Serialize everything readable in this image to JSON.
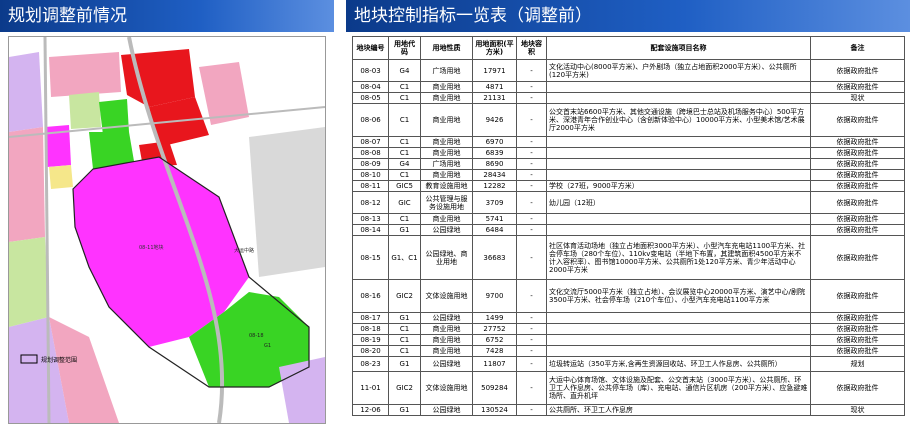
{
  "headers": {
    "left": "规划调整前情况",
    "right": "地块控制指标一览表（调整前）"
  },
  "map": {
    "legend_label": "规划调整范围",
    "labels": {
      "plot_magenta": "08-11地块",
      "road_label": "大运中路",
      "label_g1": "08-18",
      "label_c1": "G1"
    },
    "colors": {
      "commercial": "#e8161d",
      "residential_pink": "#f2a6c0",
      "green": "#39d424",
      "education": "#ff33ff",
      "light_green": "#c8e6a0",
      "grey": "#d9d9d9",
      "lavender": "#d4b4f0",
      "yellow": "#f5e78a"
    }
  },
  "table": {
    "columns": [
      "地块编号",
      "用地代码",
      "用地性质",
      "用地面积(平方米)",
      "地块容积",
      "配套设施项目名称",
      "备注"
    ],
    "rows": [
      [
        "08-03",
        "G4",
        "广场用地",
        "17971",
        "-",
        "文化活动中心(8000平方米)、户外剧场（独立占地面积2000平方米）、公共厕所(120平方米)",
        "依据政府批件"
      ],
      [
        "08-04",
        "C1",
        "商业用地",
        "4871",
        "-",
        "",
        "依据政府批件"
      ],
      [
        "08-05",
        "C1",
        "商业用地",
        "21131",
        "-",
        "",
        "现状"
      ],
      [
        "08-06",
        "C1",
        "商业用地",
        "9426",
        "-",
        "公交首末站6600平方米、其他交通设施（跨境巴士总站及机场服务中心）500平方米、深港青年合作创业中心（含创新体验中心）10000平方米、小型美术馆/艺术展厅2000平方米",
        "依据政府批件"
      ],
      [
        "08-07",
        "C1",
        "商业用地",
        "6970",
        "-",
        "",
        "依据政府批件"
      ],
      [
        "08-08",
        "C1",
        "商业用地",
        "6839",
        "-",
        "",
        "依据政府批件"
      ],
      [
        "08-09",
        "G4",
        "广场用地",
        "8690",
        "-",
        "",
        "依据政府批件"
      ],
      [
        "08-10",
        "C1",
        "商业用地",
        "28434",
        "-",
        "",
        "依据政府批件"
      ],
      [
        "08-11",
        "GIC5",
        "教育设施用地",
        "12282",
        "-",
        "学校（27班，9000平方米）",
        "依据政府批件"
      ],
      [
        "08-12",
        "GIC",
        "公共管理与服务设施用地",
        "3709",
        "-",
        "幼儿园（12班）",
        "依据政府批件"
      ],
      [
        "08-13",
        "C1",
        "商业用地",
        "5741",
        "-",
        "",
        "依据政府批件"
      ],
      [
        "08-14",
        "G1",
        "公园绿地",
        "6484",
        "-",
        "",
        "依据政府批件"
      ],
      [
        "08-15",
        "G1、C1",
        "公园绿地、商业用地",
        "36683",
        "-",
        "社区体育活动场地（独立占地面积3000平方米）、小型汽车充电站1100平方米、社会停车场（280个车位）、110kv变电站（半地下布置，其建筑面积4500平方米不计入容积率）、图书馆10000平方米、公共厕所1处120平方米、青少年活动中心2000平方米",
        "依据政府批件"
      ],
      [
        "08-16",
        "GIC2",
        "文体设施用地",
        "9700",
        "-",
        "文化交流厅5000平方米（独立占地）、会议展览中心20000平方米、演艺中心/剧院3500平方米、社会停车场（210个车位）、小型汽车充电站1100平方米",
        "依据政府批件"
      ],
      [
        "08-17",
        "G1",
        "公园绿地",
        "1499",
        "-",
        "",
        "依据政府批件"
      ],
      [
        "08-18",
        "C1",
        "商业用地",
        "27752",
        "-",
        "",
        "依据政府批件"
      ],
      [
        "08-19",
        "C1",
        "商业用地",
        "6752",
        "-",
        "",
        "依据政府批件"
      ],
      [
        "08-20",
        "C1",
        "商业用地",
        "7428",
        "-",
        "",
        "依据政府批件"
      ],
      [
        "08-23",
        "G1",
        "公园绿地",
        "11807",
        "-",
        "垃圾转运站（350平方米,含再生资源回收站、环卫工人作息房、公共厕所）",
        "规划"
      ],
      [
        "11-01",
        "GIC2",
        "文体设施用地",
        "509284",
        "-",
        "大运中心体育场馆、文体设施及配套、公交首末站（3000平方米）、公共厕所、环卫工人作息房、公共停车场（库）、充电站、通信片区机房（200平方米）、应急避难场所、直升机坪",
        "依据政府批件"
      ],
      [
        "12-06",
        "G1",
        "公园绿地",
        "130524",
        "-",
        "公共厕所、环卫工人作息房",
        "现状"
      ]
    ]
  }
}
